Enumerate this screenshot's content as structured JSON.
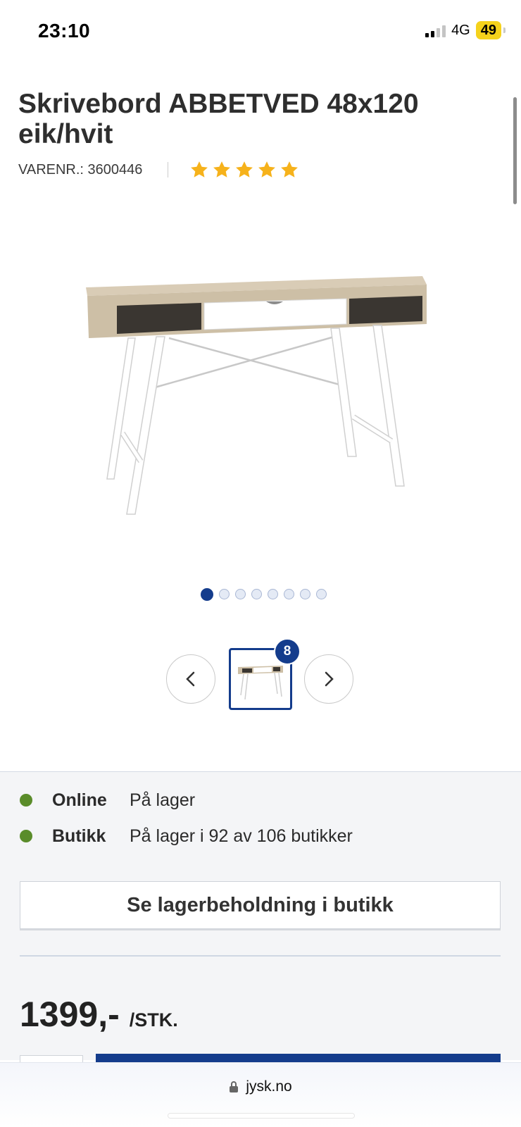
{
  "status_bar": {
    "time": "23:10",
    "network": "4G",
    "battery": "49"
  },
  "product": {
    "title": "Skrivebord ABBETVED 48x120 eik/hvit",
    "sku": "VARENR.: 3600446",
    "rating_stars": 5,
    "image_icon": "desk-image",
    "gallery_count": "8",
    "gallery_total": 8,
    "gallery_active": 0
  },
  "stock": {
    "online_label": "Online",
    "online_value": "På lager",
    "store_label": "Butikk",
    "store_value": "På lager i 92 av 106 butikker",
    "store_button": "Se lagerbeholdning i butikk",
    "status_color": "#5a8c2a"
  },
  "price": {
    "amount": "1399,-",
    "unit": "/STK."
  },
  "browser": {
    "url": "jysk.no"
  },
  "colors": {
    "brand": "#143c8c",
    "star": "#f6b21b"
  }
}
